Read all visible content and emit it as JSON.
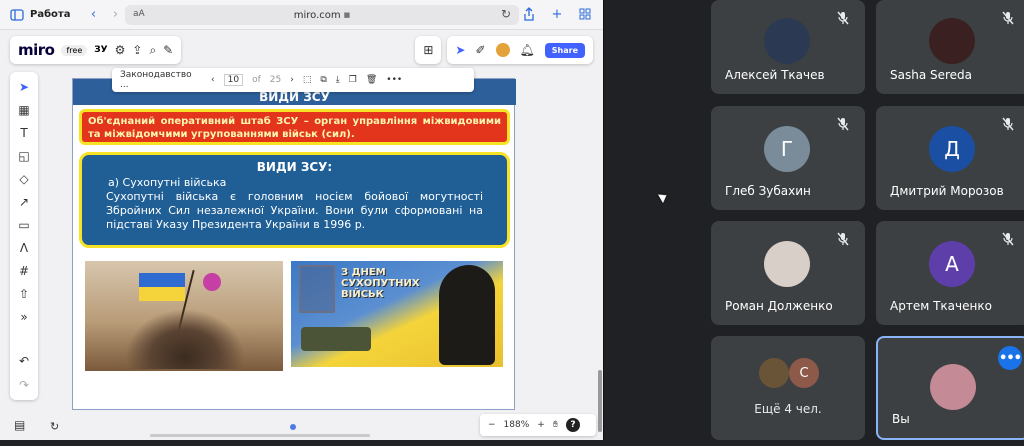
{
  "browser": {
    "tab_label": "Работа",
    "aa_label": "аА",
    "address": "miro.com",
    "lock": "🔒"
  },
  "miro": {
    "logo": "miro",
    "plan_badge": "free",
    "board_name": "ЗУ",
    "share_label": "Share",
    "zoom": "188%",
    "help": "?"
  },
  "slide_bar": {
    "name": "Законодавство ...",
    "current": "10",
    "of": "of",
    "total": "25"
  },
  "slide": {
    "title": "ВИДИ ЗСУ",
    "red_box_text": "Об'єднаний оперативний штаб ЗСУ – орган управління міжвидовими та міжвідомчими угрупованнями військ (сил).",
    "blue_head": "ВИДИ ЗСУ:",
    "blue_sub": "а) Сухопутні війська",
    "blue_text": "Сухопутні війська є головним носієм бойової могутності Збройних Сил незалежної України. Вони були сформовані на підставі Указу Президента України в 1996 р.",
    "image2_headline": "З ДНЕМ СУХОПУТНИХ ВІЙСЬК"
  },
  "participants": [
    {
      "name": "Алексей Ткачев",
      "initial": "",
      "color": "#2b3a52",
      "muted": true
    },
    {
      "name": "Sasha Sereda",
      "initial": "",
      "color": "#3a2020",
      "muted": true
    },
    {
      "name": "Глеб Зубахин",
      "initial": "Г",
      "color": "#7a8c99",
      "muted": true
    },
    {
      "name": "Дмитрий Морозов",
      "initial": "Д",
      "color": "#1a4fa3",
      "muted": true
    },
    {
      "name": "Роман Долженко",
      "initial": "",
      "color": "#d8d0c8",
      "muted": true
    },
    {
      "name": "Артем Ткаченко",
      "initial": "А",
      "color": "#5e3ea8",
      "muted": true
    }
  ],
  "others": {
    "label": "Ещё 4 чел.",
    "initial": "С",
    "color": "#8d5a4a"
  },
  "self": {
    "name": "Вы",
    "more": "•••"
  }
}
